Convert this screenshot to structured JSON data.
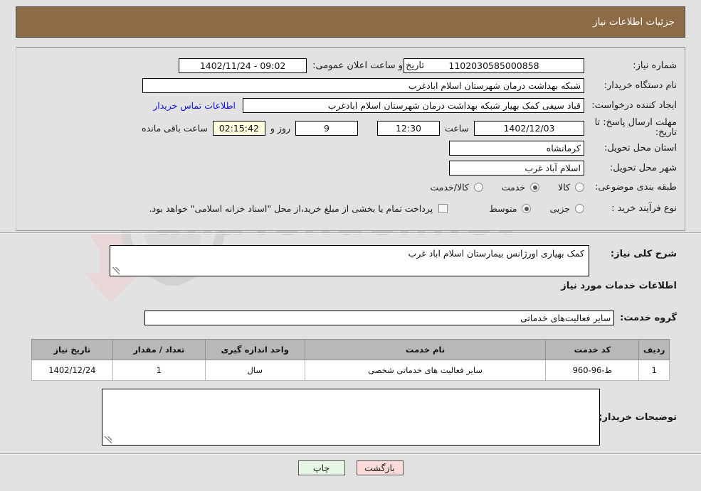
{
  "header": {
    "title": "جزئیات اطلاعات نیاز"
  },
  "form": {
    "need_number_label": "شماره نیاز:",
    "need_number_value": "1102030585000858",
    "announce_label": "تاریخ و ساعت اعلان عمومی:",
    "announce_value": "09:02 - 1402/11/24",
    "buyer_org_label": "نام دستگاه خریدار:",
    "buyer_org_value": "شبکه بهداشت درمان شهرستان اسلام ابادغرب",
    "creator_label": "ایجاد کننده درخواست:",
    "creator_value": "قباد سیفی کمک بهیار شبکه بهداشت درمان شهرستان اسلام ابادغرب",
    "contact_link": "اطلاعات تماس خریدار",
    "deadline_label": "مهلت ارسال پاسخ: تا تاریخ:",
    "deadline_date": "1402/12/03",
    "hour_label": "ساعت",
    "deadline_time": "12:30",
    "days_value": "9",
    "days_label": "روز و",
    "timer_value": "02:15:42",
    "remaining_label": "ساعت باقی مانده",
    "province_label": "استان محل تحویل:",
    "province_value": "کرمانشاه",
    "city_label": "شهر محل تحویل:",
    "city_value": "اسلام آباد غرب",
    "category_label": "طبقه بندی موضوعی:",
    "category_options": [
      {
        "label": "کالا",
        "selected": false
      },
      {
        "label": "خدمت",
        "selected": true
      },
      {
        "label": "کالا/خدمت",
        "selected": false
      }
    ],
    "process_label": "نوع فرآیند خرید :",
    "process_options": [
      {
        "label": "جزیی",
        "selected": false
      },
      {
        "label": "متوسط",
        "selected": true
      }
    ],
    "treasury_checkbox_checked": false,
    "treasury_text": "پرداخت تمام یا بخشی از مبلغ خرید،از محل \"اسناد خزانه اسلامی\" خواهد بود."
  },
  "description": {
    "label": "شرح کلی نیاز:",
    "value": "کمک بهیاری اورژانس بیمارستان اسلام اباد غرب"
  },
  "services_section": {
    "heading": "اطلاعات خدمات مورد نیاز",
    "group_label": "گروه خدمت:",
    "group_value": "سایر فعالیت‌های خدماتی"
  },
  "table": {
    "columns": [
      "ردیف",
      "کد خدمت",
      "نام خدمت",
      "واحد اندازه گیری",
      "تعداد / مقدار",
      "تاریخ نیاز"
    ],
    "rows": [
      {
        "row_no": "1",
        "service_code": "ط-96-960",
        "service_name": "سایر فعالیت های خدماتی شخصی",
        "unit": "سال",
        "quantity": "1",
        "need_date": "1402/12/24"
      }
    ]
  },
  "buyer_notes": {
    "label": "توضیحات خریدار;",
    "value": ""
  },
  "footer": {
    "back_label": "بازگشت",
    "print_label": "چاپ"
  },
  "watermark": {
    "text": "anaTender.net"
  },
  "colors": {
    "header_bg": "#8d6b46",
    "page_bg": "#e2e2e2",
    "link": "#1414dd",
    "timer_bg": "#ffffdd",
    "table_header_bg": "#b8b8b8",
    "back_button_bg": "#fcdada",
    "print_button_bg": "#e6f7e6"
  }
}
